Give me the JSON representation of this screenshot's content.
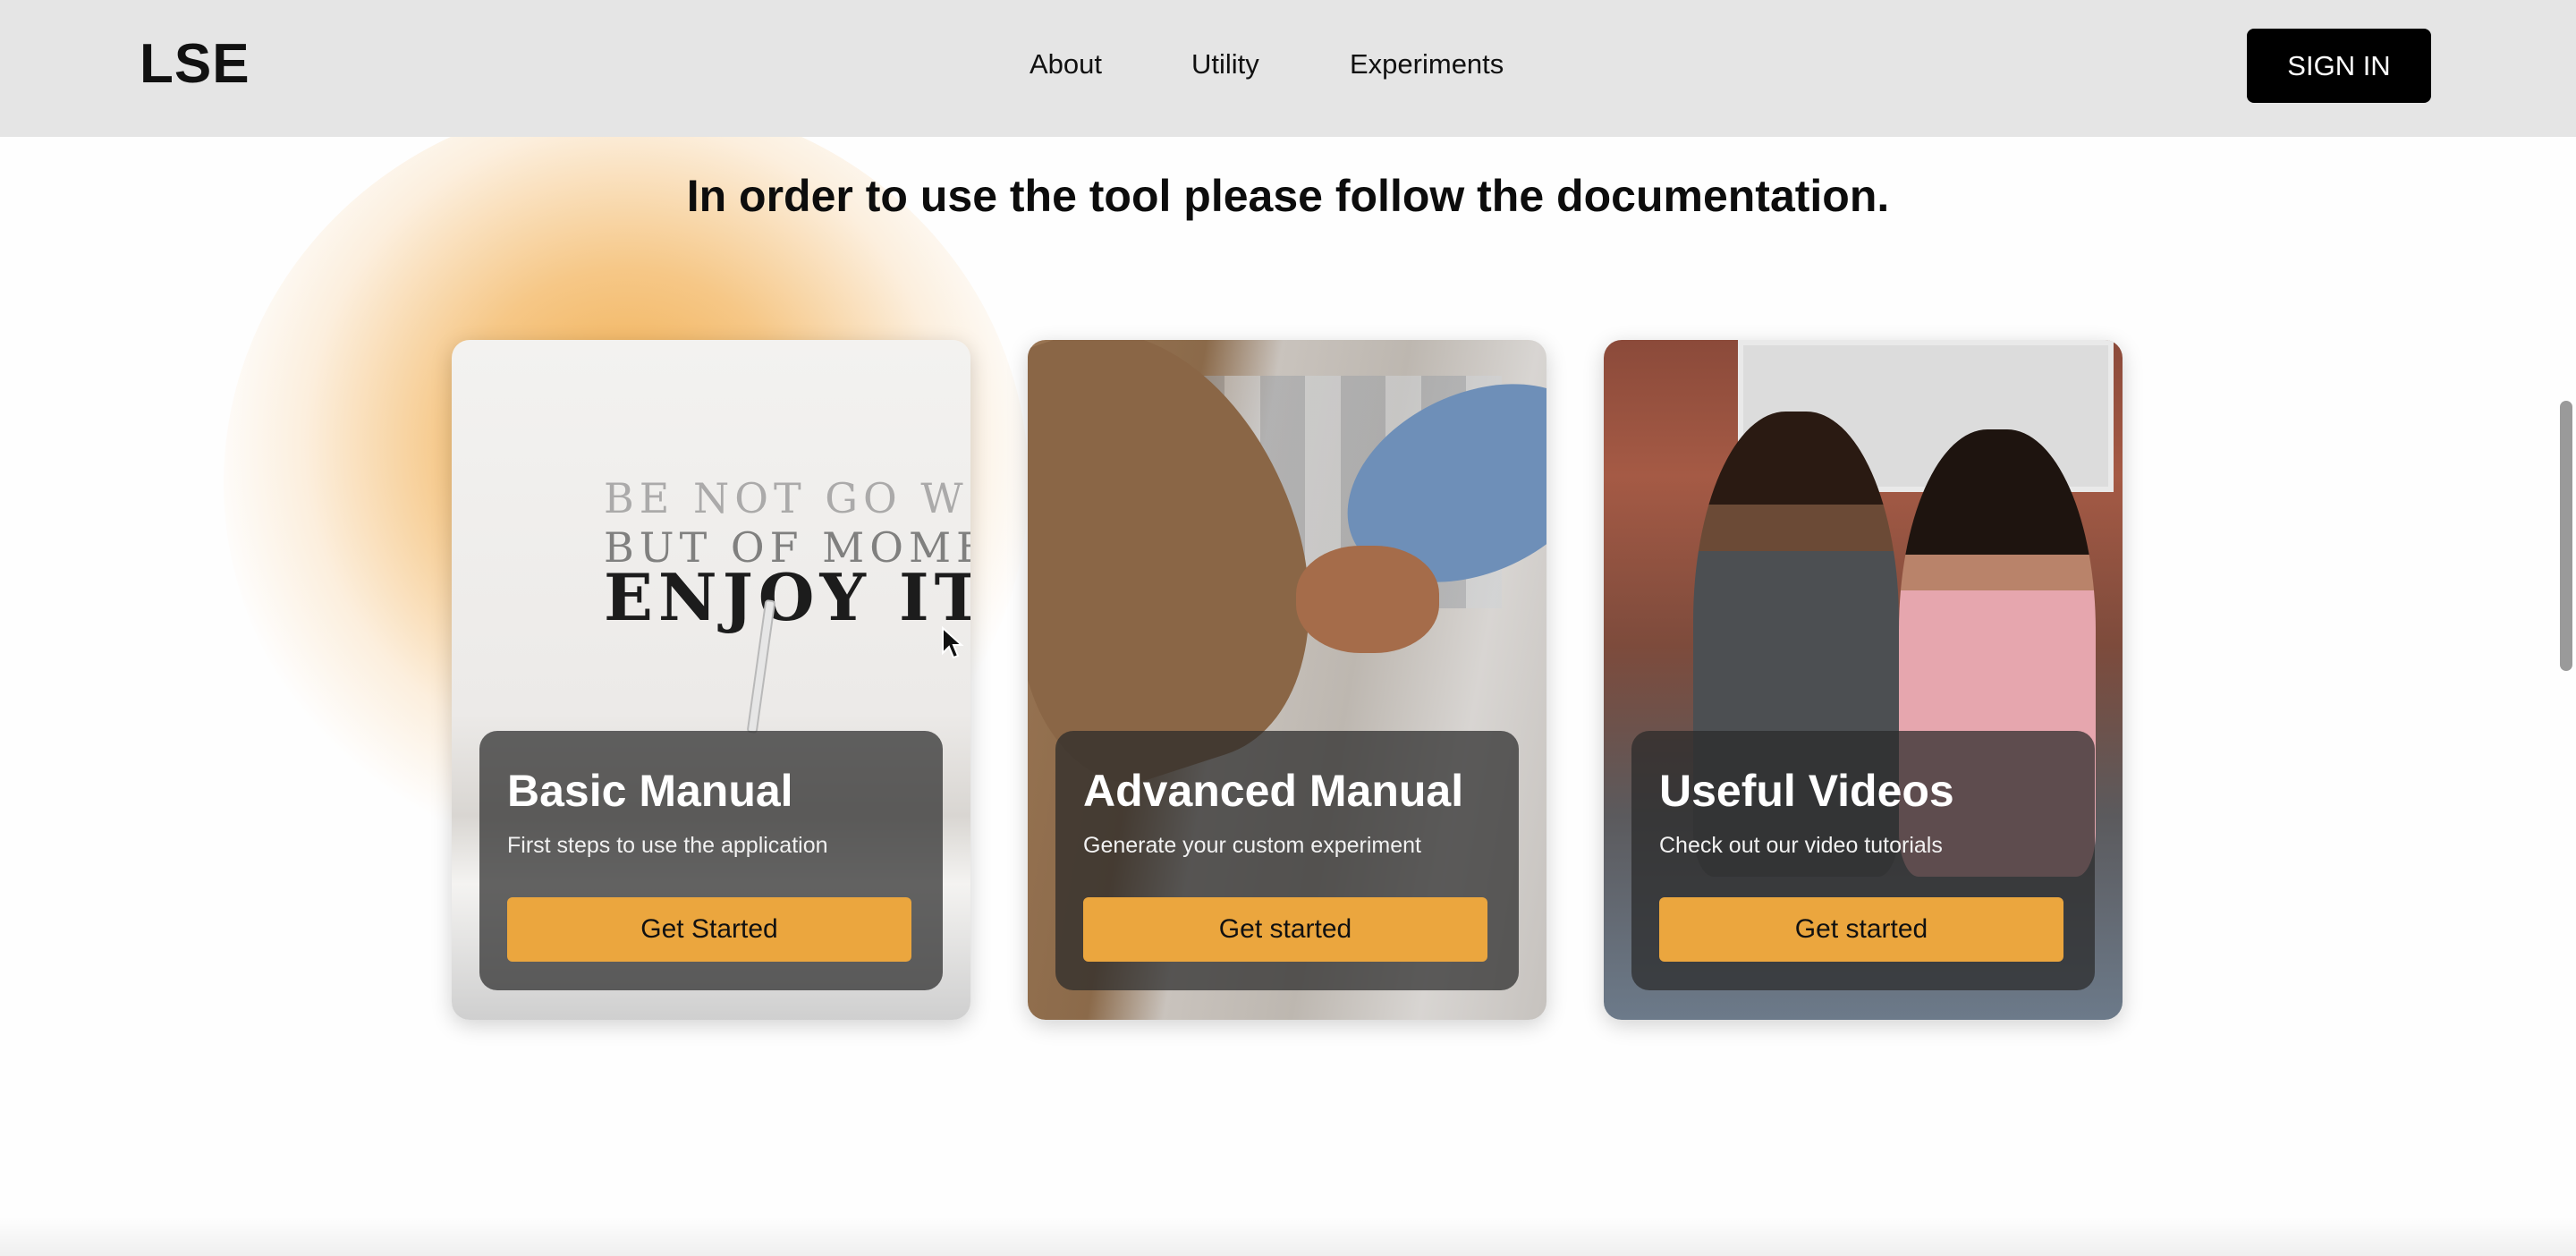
{
  "header": {
    "logo": "LSE",
    "nav": [
      {
        "label": "About"
      },
      {
        "label": "Utility"
      },
      {
        "label": "Experiments"
      }
    ],
    "signin_label": "SIGN IN"
  },
  "main": {
    "headline": "In order to use the tool please follow the documentation."
  },
  "cards": [
    {
      "title": "Basic Manual",
      "subtitle": "First steps to use the application",
      "button": "Get Started"
    },
    {
      "title": "Advanced Manual",
      "subtitle": "Generate your custom experiment",
      "button": "Get started"
    },
    {
      "title": "Useful Videos",
      "subtitle": "Check out our video tutorials",
      "button": "Get started"
    }
  ],
  "photo_text": {
    "line_a": "BE NOT GO WHERE THE PATH MAY LE",
    "line_b": "BUT OF MOMENT LIFE IS A JOURNEY",
    "line_c": "ENJOY IT"
  },
  "colors": {
    "accent": "#eba63e",
    "header_bg": "#e5e5e5",
    "signin_bg": "#000000"
  },
  "icons": {
    "cursor": "mouse-pointer-icon"
  }
}
